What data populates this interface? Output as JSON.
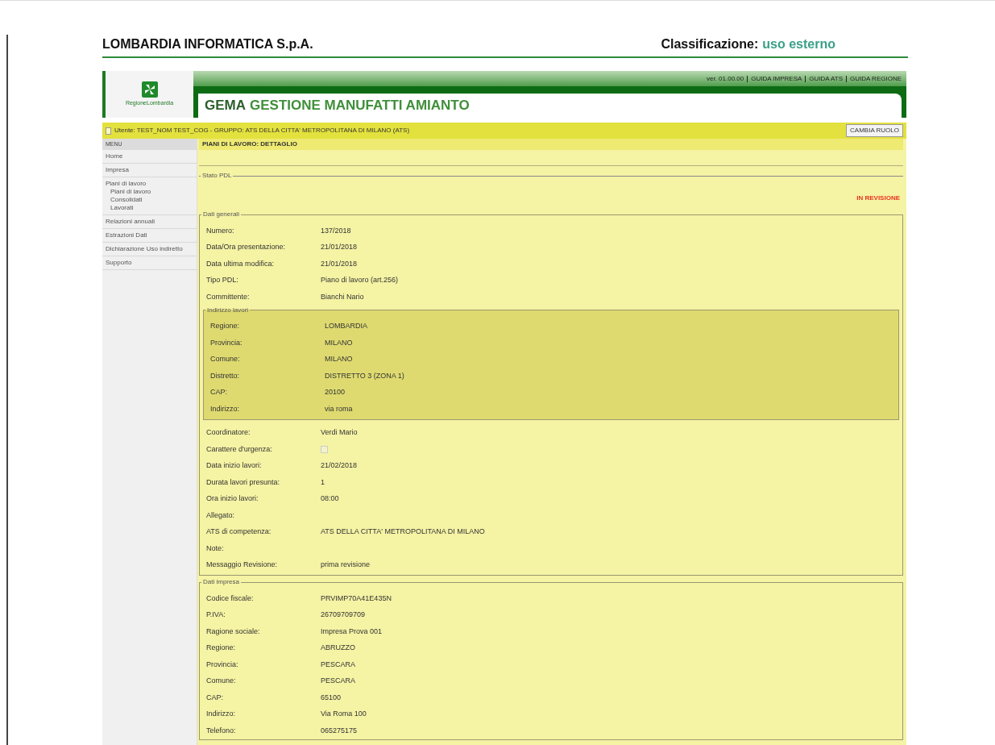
{
  "doc_header": {
    "company": "LOMBARDIA INFORMATICA S.p.A.",
    "classification_label": "Classificazione:",
    "classification_value": "uso esterno"
  },
  "app": {
    "logo_text": "RegioneLombardia",
    "title_strong": "GEMA",
    "title_rest": "GESTIONE MANUFATTI AMIANTO",
    "top_links": [
      "ver. 01.00.00",
      "GUIDA IMPRESA",
      "GUIDA ATS",
      "GUIDA REGIONE"
    ],
    "user_bar": "Utente: TEST_NOM TEST_COG - GRUPPO: ATS DELLA CITTA' METROPOLITANA DI MILANO (ATS)",
    "role_button": "CAMBIA RUOLO"
  },
  "sidebar": {
    "title": "MENU",
    "items": [
      {
        "label": "Home"
      },
      {
        "label": "Impresa"
      },
      {
        "label": "Piani di lavoro",
        "children": [
          {
            "label": "Piani di lavoro"
          },
          {
            "label": "Consolidati"
          },
          {
            "label": "Lavorati"
          }
        ]
      },
      {
        "label": "Relazioni annuali"
      },
      {
        "label": "Estrazioni Dati"
      },
      {
        "label": "Dichiarazione Uso indiretto"
      },
      {
        "label": "Supporto"
      }
    ]
  },
  "page_title": "PIANI DI LAVORO: DETTAGLIO",
  "status": {
    "legend": "Stato PDL",
    "value": "IN REVISIONE"
  },
  "general": {
    "legend": "Dati generali",
    "rows_top": [
      {
        "kind": "text",
        "label": "Numero:",
        "value": "137/2018"
      },
      {
        "kind": "text",
        "label": "Data/Ora presentazione:",
        "value": "21/01/2018"
      },
      {
        "kind": "text",
        "label": "Data ultima modifica:",
        "value": "21/01/2018"
      },
      {
        "kind": "text",
        "label": "Tipo PDL:",
        "value": "Piano di lavoro (art.256)"
      },
      {
        "kind": "text",
        "label": "Committente:",
        "value": "Bianchi Nario"
      }
    ],
    "address": {
      "legend": "Indirizzo lavori",
      "rows": [
        {
          "label": "Regione:",
          "value": "LOMBARDIA"
        },
        {
          "label": "Provincia:",
          "value": "MILANO"
        },
        {
          "label": "Comune:",
          "value": "MILANO"
        },
        {
          "label": "Distretto:",
          "value": "DISTRETTO 3 (ZONA 1)"
        },
        {
          "label": "CAP:",
          "value": "20100"
        },
        {
          "label": "Indirizzo:",
          "value": "via roma"
        }
      ]
    },
    "rows_bottom": [
      {
        "kind": "text",
        "label": "Coordinatore:",
        "value": "Verdi Mario"
      },
      {
        "kind": "checkbox",
        "label": "Carattere d'urgenza:",
        "checked": false
      },
      {
        "kind": "text",
        "label": "Data inizio lavori:",
        "value": "21/02/2018"
      },
      {
        "kind": "text",
        "label": "Durata lavori presunta:",
        "value": "1"
      },
      {
        "kind": "text",
        "label": "Ora inizio lavori:",
        "value": "08:00"
      },
      {
        "kind": "text",
        "label": "Allegato:"
      },
      {
        "kind": "text",
        "label": "ATS di competenza:",
        "value": "ATS DELLA CITTA' METROPOLITANA DI MILANO"
      },
      {
        "kind": "text",
        "label": "Note:"
      },
      {
        "kind": "text",
        "label": "Messaggio Revisione:",
        "value": "prima revisione"
      }
    ]
  },
  "company": {
    "legend": "Dati impresa",
    "rows": [
      {
        "label": "Codice fiscale:",
        "value": "PRVIMP70A41E435N"
      },
      {
        "label": "P.IVA:",
        "value": "26709709709"
      },
      {
        "label": "Ragione sociale:",
        "value": "Impresa Prova 001"
      },
      {
        "label": "Regione:",
        "value": "ABRUZZO"
      },
      {
        "label": "Provincia:",
        "value": "PESCARA"
      },
      {
        "label": "Comune:",
        "value": "PESCARA"
      },
      {
        "label": "CAP:",
        "value": "65100"
      },
      {
        "label": "Indirizzo:",
        "value": "Via Roma 100"
      },
      {
        "label": "Telefono:",
        "value": "065275175"
      }
    ]
  }
}
